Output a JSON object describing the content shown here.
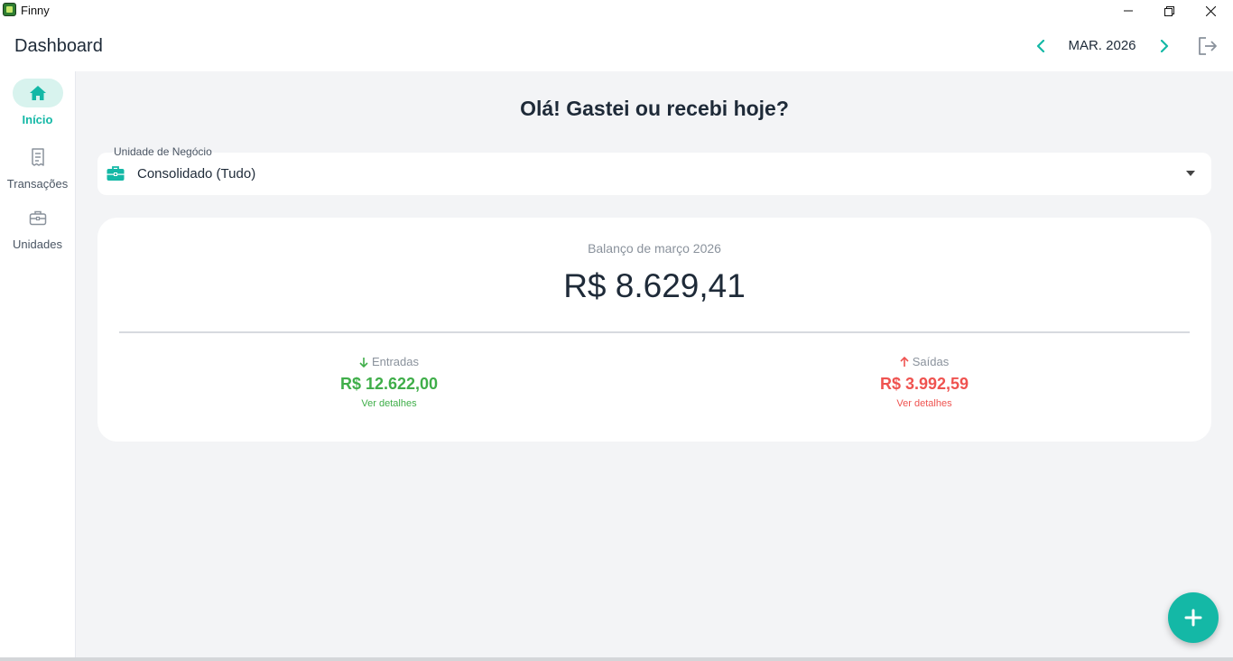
{
  "window": {
    "title": "Finny"
  },
  "header": {
    "title": "Dashboard",
    "month": "MAR. 2026"
  },
  "sidebar": {
    "items": [
      {
        "label": "Início",
        "icon": "home-icon",
        "active": true
      },
      {
        "label": "Transações",
        "icon": "receipt-icon",
        "active": false
      },
      {
        "label": "Unidades",
        "icon": "briefcase-icon",
        "active": false
      }
    ]
  },
  "main": {
    "greeting": "Olá! Gastei ou recebi hoje?",
    "business_unit": {
      "label": "Unidade de Negócio",
      "value": "Consolidado (Tudo)"
    },
    "balance": {
      "caption": "Balanço de março 2026",
      "value": "R$ 8.629,41"
    },
    "income": {
      "label": "Entradas",
      "amount": "R$ 12.622,00",
      "link": "Ver detalhes"
    },
    "expense": {
      "label": "Saídas",
      "amount": "R$ 3.992,59",
      "link": "Ver detalhes"
    }
  },
  "colors": {
    "accent": "#14b8a6",
    "income": "#3fae49",
    "expense": "#ef5350",
    "background": "#f3f4f6"
  }
}
